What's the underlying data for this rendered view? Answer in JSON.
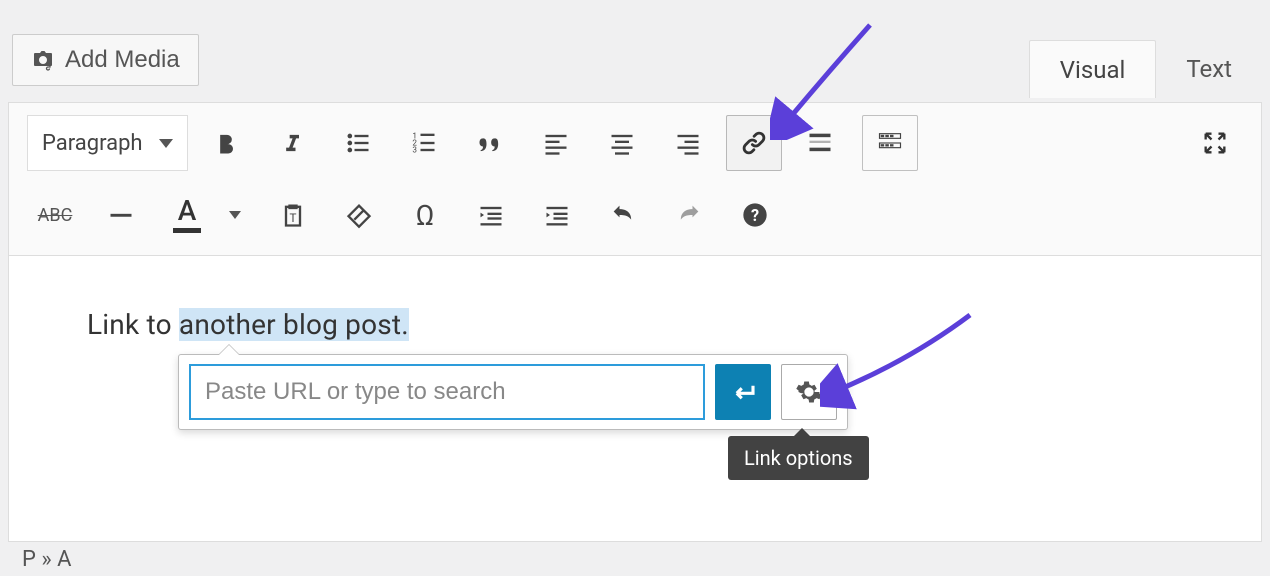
{
  "addMedia": {
    "label": "Add Media"
  },
  "tabs": {
    "visual": "Visual",
    "text": "Text"
  },
  "paragraphSelect": {
    "label": "Paragraph"
  },
  "editor": {
    "before": "Link to ",
    "highlight": "another blog post.",
    "after": ""
  },
  "linkPopup": {
    "placeholder": "Paste URL or type to search",
    "value": ""
  },
  "tooltip": {
    "label": "Link options"
  },
  "breadcrumb": {
    "p": "P",
    "sep": " » ",
    "a": "A"
  }
}
